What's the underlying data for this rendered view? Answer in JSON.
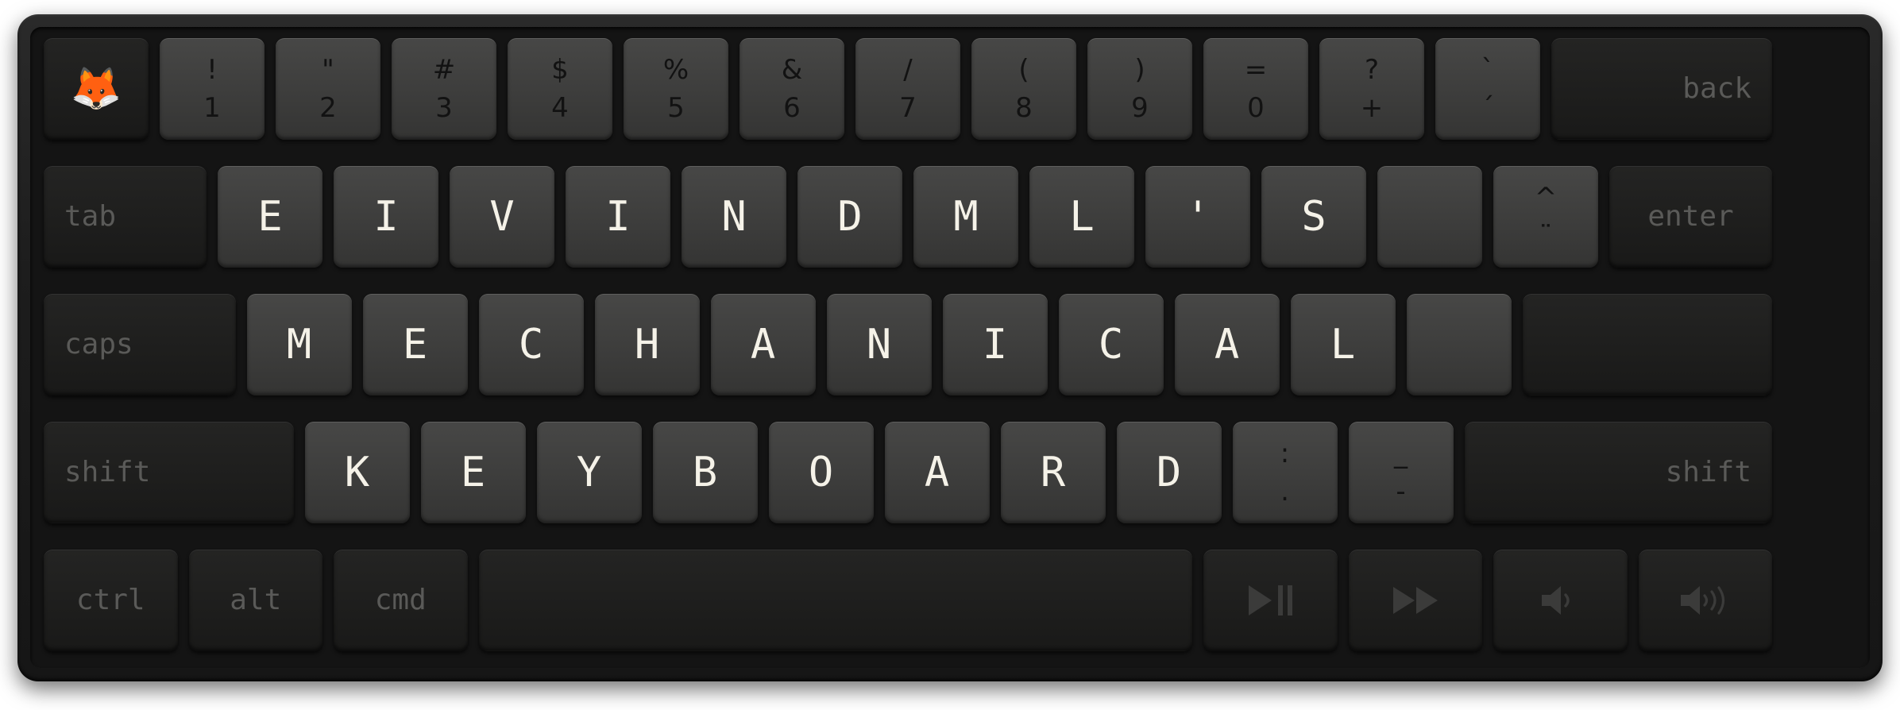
{
  "device": {
    "name": "60-percent-mechanical-keyboard",
    "case_color": "#1d1d1d",
    "plate_color": "#141414",
    "alpha_cap_color": "#3d3d3c",
    "modifier_cap_color": "#1e1e1d",
    "alpha_legend_color": "#f5f2e8",
    "symbol_legend_color": "#121212",
    "modifier_legend_color": "#5a5a58",
    "accent_color": "#e8751a"
  },
  "rows": [
    {
      "id": "number-row",
      "keys": [
        {
          "name": "fox-emoji-key",
          "style": "dark",
          "legend": "emoji",
          "glyph": "🦊",
          "units": 1
        },
        {
          "name": "key-1",
          "style": "light",
          "legend": "duo",
          "top": "!",
          "bottom": "1",
          "units": 1
        },
        {
          "name": "key-2",
          "style": "light",
          "legend": "duo",
          "top": "\"",
          "bottom": "2",
          "units": 1
        },
        {
          "name": "key-3",
          "style": "light",
          "legend": "duo",
          "top": "#",
          "bottom": "3",
          "units": 1
        },
        {
          "name": "key-4",
          "style": "light",
          "legend": "duo",
          "top": "$",
          "bottom": "4",
          "units": 1
        },
        {
          "name": "key-5",
          "style": "light",
          "legend": "duo",
          "top": "%",
          "bottom": "5",
          "units": 1
        },
        {
          "name": "key-6",
          "style": "light",
          "legend": "duo",
          "top": "&",
          "bottom": "6",
          "units": 1
        },
        {
          "name": "key-7",
          "style": "light",
          "legend": "duo",
          "top": "/",
          "bottom": "7",
          "units": 1
        },
        {
          "name": "key-8",
          "style": "light",
          "legend": "duo",
          "top": "(",
          "bottom": "8",
          "units": 1
        },
        {
          "name": "key-9",
          "style": "light",
          "legend": "duo",
          "top": ")",
          "bottom": "9",
          "units": 1
        },
        {
          "name": "key-0",
          "style": "light",
          "legend": "duo",
          "top": "=",
          "bottom": "0",
          "units": 1
        },
        {
          "name": "key-plus",
          "style": "light",
          "legend": "duo",
          "top": "?",
          "bottom": "+",
          "units": 1
        },
        {
          "name": "key-acute",
          "style": "light",
          "legend": "duo",
          "top": "`",
          "bottom": "´",
          "units": 1
        },
        {
          "name": "backspace-key",
          "style": "dark",
          "legend": "word",
          "label": "back",
          "align": "right",
          "units": 2
        }
      ]
    },
    {
      "id": "top-letter-row",
      "keys": [
        {
          "name": "tab-key",
          "style": "dark",
          "legend": "word",
          "label": "tab",
          "align": "left",
          "units": 1.5
        },
        {
          "name": "key-e",
          "style": "light",
          "legend": "alpha",
          "glyph": "E",
          "units": 1
        },
        {
          "name": "key-i",
          "style": "light",
          "legend": "alpha",
          "glyph": "I",
          "units": 1
        },
        {
          "name": "key-v",
          "style": "light",
          "legend": "alpha",
          "glyph": "V",
          "units": 1
        },
        {
          "name": "key-i-2",
          "style": "light",
          "legend": "alpha",
          "glyph": "I",
          "units": 1
        },
        {
          "name": "key-n",
          "style": "light",
          "legend": "alpha",
          "glyph": "N",
          "units": 1
        },
        {
          "name": "key-d",
          "style": "light",
          "legend": "alpha",
          "glyph": "D",
          "units": 1
        },
        {
          "name": "key-m",
          "style": "light",
          "legend": "alpha",
          "glyph": "M",
          "units": 1
        },
        {
          "name": "key-l",
          "style": "light",
          "legend": "alpha",
          "glyph": "L",
          "units": 1
        },
        {
          "name": "key-apostrophe",
          "style": "light",
          "legend": "alpha",
          "glyph": "'",
          "units": 1
        },
        {
          "name": "key-s",
          "style": "light",
          "legend": "alpha",
          "glyph": "S",
          "units": 1
        },
        {
          "name": "key-blank-1",
          "style": "light",
          "legend": "blank",
          "units": 1
        },
        {
          "name": "key-diaeresis",
          "style": "light",
          "legend": "duo",
          "top": "^",
          "bottom": "¨",
          "units": 1
        },
        {
          "name": "enter-key",
          "style": "dark",
          "legend": "word",
          "label": "enter",
          "align": "center",
          "units": 1.5
        }
      ]
    },
    {
      "id": "home-letter-row",
      "keys": [
        {
          "name": "caps-lock-key",
          "style": "dark",
          "legend": "word",
          "label": "caps",
          "align": "left",
          "units": 1.75
        },
        {
          "name": "key-m-2",
          "style": "light",
          "legend": "alpha",
          "glyph": "M",
          "units": 1
        },
        {
          "name": "key-e-2",
          "style": "light",
          "legend": "alpha",
          "glyph": "E",
          "units": 1
        },
        {
          "name": "key-c",
          "style": "light",
          "legend": "alpha",
          "glyph": "C",
          "units": 1
        },
        {
          "name": "key-h",
          "style": "light",
          "legend": "alpha",
          "glyph": "H",
          "units": 1
        },
        {
          "name": "key-a",
          "style": "light",
          "legend": "alpha",
          "glyph": "A",
          "units": 1
        },
        {
          "name": "key-n-2",
          "style": "light",
          "legend": "alpha",
          "glyph": "N",
          "units": 1
        },
        {
          "name": "key-i-3",
          "style": "light",
          "legend": "alpha",
          "glyph": "I",
          "units": 1
        },
        {
          "name": "key-c-2",
          "style": "light",
          "legend": "alpha",
          "glyph": "C",
          "units": 1
        },
        {
          "name": "key-a-2",
          "style": "light",
          "legend": "alpha",
          "glyph": "A",
          "units": 1
        },
        {
          "name": "key-l-2",
          "style": "light",
          "legend": "alpha",
          "glyph": "L",
          "units": 1
        },
        {
          "name": "key-blank-2",
          "style": "light",
          "legend": "blank",
          "units": 1
        },
        {
          "name": "key-blank-wide",
          "style": "dark",
          "legend": "blank",
          "units": 2.25
        }
      ]
    },
    {
      "id": "bottom-letter-row",
      "keys": [
        {
          "name": "left-shift-key",
          "style": "dark",
          "legend": "word",
          "label": "shift",
          "align": "left",
          "units": 2.25
        },
        {
          "name": "key-k",
          "style": "light",
          "legend": "alpha",
          "glyph": "K",
          "units": 1
        },
        {
          "name": "key-e-3",
          "style": "light",
          "legend": "alpha",
          "glyph": "E",
          "units": 1
        },
        {
          "name": "key-y",
          "style": "light",
          "legend": "alpha",
          "glyph": "Y",
          "units": 1
        },
        {
          "name": "key-b",
          "style": "light",
          "legend": "alpha",
          "glyph": "B",
          "units": 1
        },
        {
          "name": "key-o",
          "style": "light",
          "legend": "alpha",
          "glyph": "O",
          "units": 1
        },
        {
          "name": "key-a-3",
          "style": "light",
          "legend": "alpha",
          "glyph": "A",
          "units": 1
        },
        {
          "name": "key-r",
          "style": "light",
          "legend": "alpha",
          "glyph": "R",
          "units": 1
        },
        {
          "name": "key-d-2",
          "style": "light",
          "legend": "alpha",
          "glyph": "D",
          "units": 1
        },
        {
          "name": "key-colon",
          "style": "light",
          "legend": "duo",
          "top": ":",
          "bottom": ".",
          "units": 1
        },
        {
          "name": "key-underscore",
          "style": "light",
          "legend": "duo",
          "top": "_",
          "bottom": "-",
          "units": 1
        },
        {
          "name": "right-shift-key",
          "style": "dark",
          "legend": "word",
          "label": "shift",
          "align": "right",
          "units": 2.75
        }
      ]
    },
    {
      "id": "modifier-row",
      "keys": [
        {
          "name": "ctrl-key",
          "style": "dark",
          "legend": "word",
          "label": "ctrl",
          "align": "center",
          "units": 1.25
        },
        {
          "name": "alt-key",
          "style": "dark",
          "legend": "word",
          "label": "alt",
          "align": "center",
          "units": 1.25
        },
        {
          "name": "cmd-key",
          "style": "dark",
          "legend": "word",
          "label": "cmd",
          "align": "center",
          "units": 1.25
        },
        {
          "name": "spacebar-key",
          "style": "dark",
          "legend": "blank",
          "units": 6.25
        },
        {
          "name": "play-pause-key",
          "style": "dark",
          "legend": "icon",
          "icon": "play-pause-icon",
          "units": 1.25
        },
        {
          "name": "fast-forward-key",
          "style": "dark",
          "legend": "icon",
          "icon": "fast-forward-icon",
          "units": 1.25
        },
        {
          "name": "volume-down-key",
          "style": "dark",
          "legend": "icon",
          "icon": "volume-down-icon",
          "units": 1.25
        },
        {
          "name": "volume-up-key",
          "style": "dark",
          "legend": "icon",
          "icon": "volume-up-icon",
          "units": 1.25
        }
      ]
    }
  ]
}
